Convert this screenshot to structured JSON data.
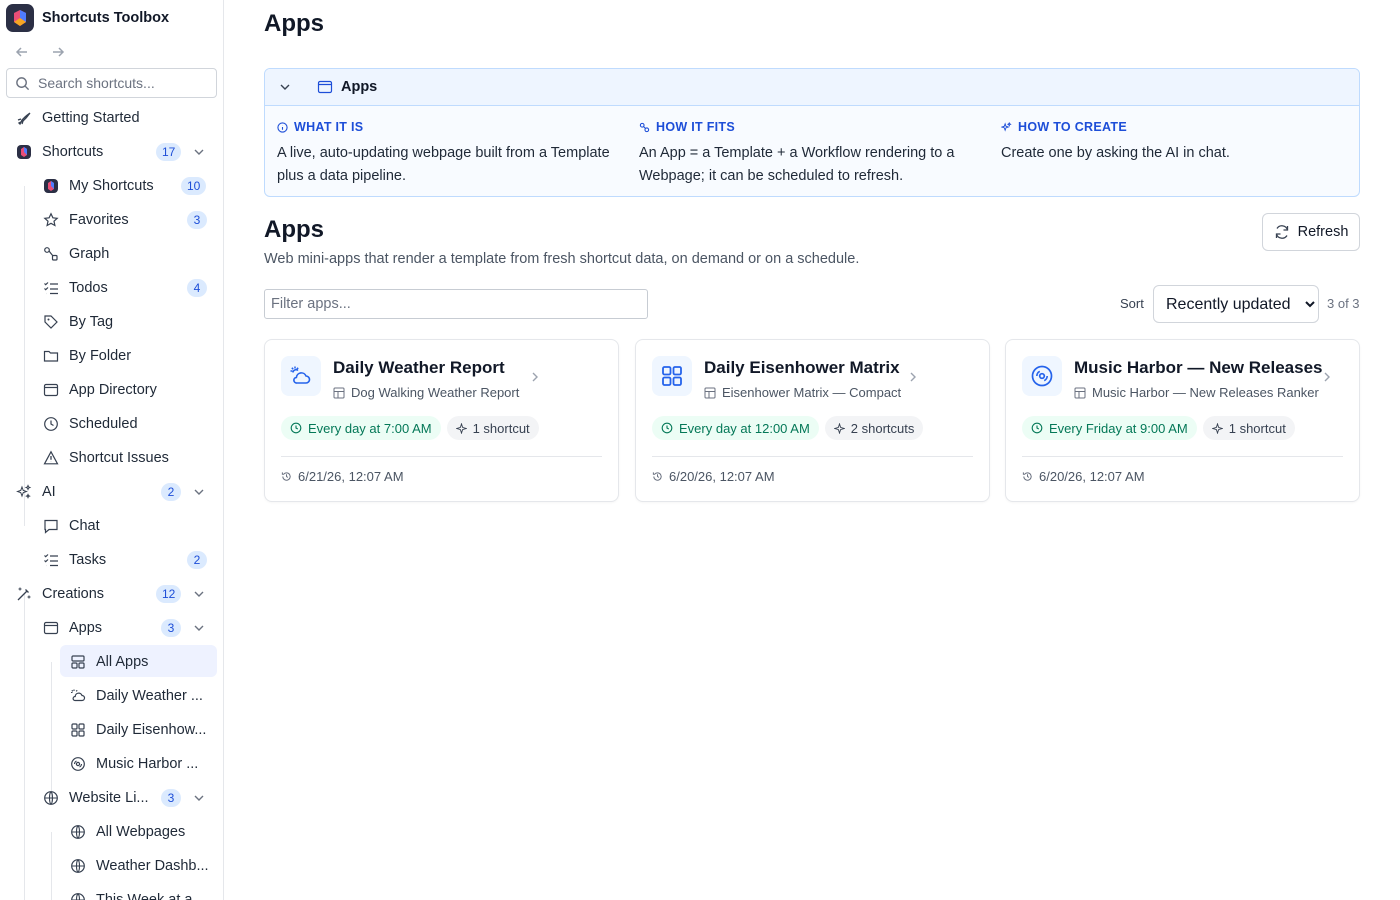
{
  "app": {
    "title": "Shortcuts Toolbox"
  },
  "sidebar": {
    "search_placeholder": "Search shortcuts...",
    "getting_started": "Getting Started",
    "shortcuts": {
      "label": "Shortcuts",
      "count": "17"
    },
    "my_shortcuts": {
      "label": "My Shortcuts",
      "count": "10"
    },
    "favorites": {
      "label": "Favorites",
      "count": "3"
    },
    "graph": "Graph",
    "todos": {
      "label": "Todos",
      "count": "4"
    },
    "by_tag": "By Tag",
    "by_folder": "By Folder",
    "app_directory": "App Directory",
    "scheduled": "Scheduled",
    "shortcut_issues": "Shortcut Issues",
    "ai": {
      "label": "AI",
      "count": "2"
    },
    "chat": "Chat",
    "tasks": {
      "label": "Tasks",
      "count": "2"
    },
    "creations": {
      "label": "Creations",
      "count": "12"
    },
    "apps": {
      "label": "Apps",
      "count": "3"
    },
    "all_apps": "All Apps",
    "app_weather": "Daily Weather ...",
    "app_eisenhower": "Daily Eisenhow...",
    "app_music": "Music Harbor ...",
    "website_links": {
      "label": "Website Li...",
      "count": "3"
    },
    "all_webpages": "All Webpages",
    "weather_dashboard": "Weather Dashb...",
    "this_week": "This Week at a..."
  },
  "main": {
    "page_title": "Apps",
    "info": {
      "title": "Apps",
      "what_h": "WHAT IT IS",
      "what_b": "A live, auto-updating webpage built from a Template plus a data pipeline.",
      "how_fits_h": "HOW IT FITS",
      "how_fits_b": "An App = a Template + a Workflow rendering to a Webpage; it can be scheduled to refresh.",
      "how_create_h": "HOW TO CREATE",
      "how_create_b": "Create one by asking the AI in chat."
    },
    "section_title": "Apps",
    "section_sub": "Web mini-apps that render a template from fresh shortcut data, on demand or on a schedule.",
    "refresh_label": "Refresh",
    "filter_placeholder": "Filter apps...",
    "sort_label": "Sort",
    "sort_value": "Recently updated",
    "count": "3 of 3",
    "cards": [
      {
        "title": "Daily Weather Report",
        "template": "Dog Walking Weather Report",
        "schedule": "Every day at 7:00 AM",
        "shortcuts": "1 shortcut",
        "updated": "6/21/26, 12:07 AM",
        "icon": "cloud-sun-icon"
      },
      {
        "title": "Daily Eisenhower Matrix",
        "template": "Eisenhower Matrix — Compact",
        "schedule": "Every day at 12:00 AM",
        "shortcuts": "2 shortcuts",
        "updated": "6/20/26, 12:07 AM",
        "icon": "grid-icon"
      },
      {
        "title": "Music Harbor — New Releases",
        "template": "Music Harbor — New Releases Ranker",
        "schedule": "Every Friday at 9:00 AM",
        "shortcuts": "1 shortcut",
        "updated": "6/20/26, 12:07 AM",
        "icon": "disc-icon"
      }
    ]
  },
  "colors": {
    "accent": "#2563eb",
    "badge_bg": "#dbeafe",
    "schedule_green": "#047857",
    "info_border": "#bfdbfe"
  }
}
